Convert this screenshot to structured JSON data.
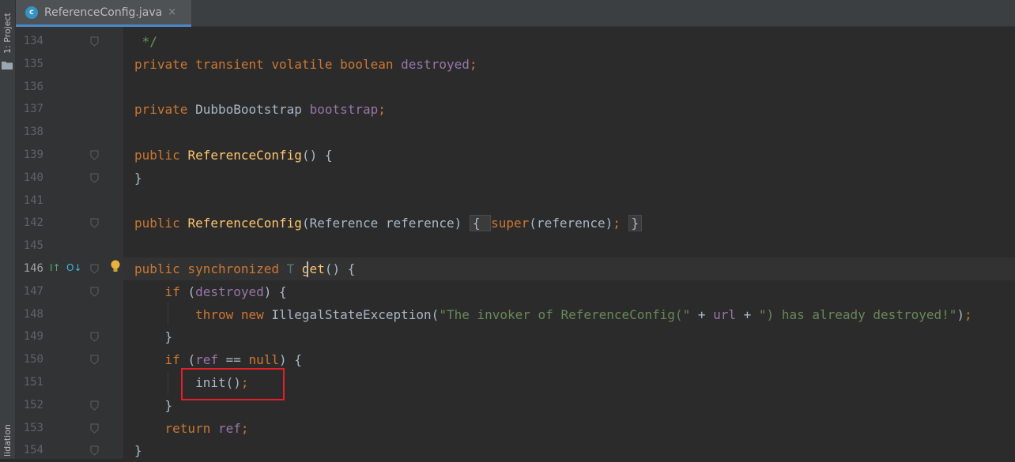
{
  "sidebar": {
    "project_label": "1: Project",
    "validation_label": "lidation"
  },
  "tab": {
    "icon_letter": "c",
    "title": "ReferenceConfig.java",
    "close_glyph": "×"
  },
  "gutter_icons": {
    "override_up": "I↑",
    "override_down": "O↓"
  },
  "colors": {
    "keyword": "#cc7832",
    "method": "#ffc66d",
    "field": "#9876aa",
    "string": "#6a8759",
    "comment": "#629755",
    "highlight_box": "#e3202a"
  },
  "lines": [
    {
      "num": "134",
      "tokens": [
        {
          "t": " */",
          "c": "cmt"
        }
      ]
    },
    {
      "num": "135",
      "tokens": [
        {
          "t": "private transient volatile boolean ",
          "c": "kw"
        },
        {
          "t": "destroyed",
          "c": "fld"
        },
        {
          "t": ";",
          "c": "kw"
        }
      ]
    },
    {
      "num": "136",
      "tokens": []
    },
    {
      "num": "137",
      "tokens": [
        {
          "t": "private ",
          "c": "kw"
        },
        {
          "t": "DubboBootstrap ",
          "c": ""
        },
        {
          "t": "bootstrap",
          "c": "fld"
        },
        {
          "t": ";",
          "c": "kw"
        }
      ]
    },
    {
      "num": "138",
      "tokens": []
    },
    {
      "num": "139",
      "tokens": [
        {
          "t": "public ",
          "c": "kw"
        },
        {
          "t": "ReferenceConfig",
          "c": "fn"
        },
        {
          "t": "() {",
          "c": ""
        }
      ]
    },
    {
      "num": "140",
      "tokens": [
        {
          "t": "}",
          "c": ""
        }
      ]
    },
    {
      "num": "141",
      "tokens": []
    },
    {
      "num": "142",
      "tokens": [
        {
          "t": "public ",
          "c": "kw"
        },
        {
          "t": "ReferenceConfig",
          "c": "fn"
        },
        {
          "t": "(Reference reference) ",
          "c": ""
        },
        {
          "t": "{ ",
          "c": "box"
        },
        {
          "t": "super",
          "c": "kw"
        },
        {
          "t": "(reference)",
          "c": ""
        },
        {
          "t": "; ",
          "c": "kw"
        },
        {
          "t": "}",
          "c": "box"
        }
      ]
    },
    {
      "num": "145",
      "tokens": []
    },
    {
      "num": "146",
      "tokens": [
        {
          "t": "public synchronized ",
          "c": "kw"
        },
        {
          "t": "T ",
          "c": "tp"
        },
        {
          "t": "get",
          "c": "fn"
        },
        {
          "t": "() {",
          "c": ""
        }
      ]
    },
    {
      "num": "147",
      "tokens": [
        {
          "t": "    if ",
          "c": "kw"
        },
        {
          "t": "(",
          "c": ""
        },
        {
          "t": "destroyed",
          "c": "fld"
        },
        {
          "t": ") {",
          "c": ""
        }
      ]
    },
    {
      "num": "148",
      "tokens": [
        {
          "t": "        throw new ",
          "c": "kw"
        },
        {
          "t": "IllegalStateException(",
          "c": ""
        },
        {
          "t": "\"The invoker of ReferenceConfig(\"",
          "c": "str"
        },
        {
          "t": " + ",
          "c": ""
        },
        {
          "t": "url",
          "c": "fld"
        },
        {
          "t": " + ",
          "c": ""
        },
        {
          "t": "\") has already destroyed!\"",
          "c": "str"
        },
        {
          "t": ")",
          "c": ""
        },
        {
          "t": ";",
          "c": "kw"
        }
      ]
    },
    {
      "num": "149",
      "tokens": [
        {
          "t": "    }",
          "c": ""
        }
      ]
    },
    {
      "num": "150",
      "tokens": [
        {
          "t": "    if ",
          "c": "kw"
        },
        {
          "t": "(",
          "c": ""
        },
        {
          "t": "ref",
          "c": "fld"
        },
        {
          "t": " == ",
          "c": ""
        },
        {
          "t": "null",
          "c": "kw"
        },
        {
          "t": ") {",
          "c": ""
        }
      ]
    },
    {
      "num": "151",
      "tokens": [
        {
          "t": "        init()",
          "c": ""
        },
        {
          "t": ";",
          "c": "kw"
        }
      ]
    },
    {
      "num": "152",
      "tokens": [
        {
          "t": "    }",
          "c": ""
        }
      ]
    },
    {
      "num": "153",
      "tokens": [
        {
          "t": "    return ",
          "c": "kw"
        },
        {
          "t": "ref",
          "c": "fld"
        },
        {
          "t": ";",
          "c": "kw"
        }
      ]
    },
    {
      "num": "154",
      "tokens": [
        {
          "t": "}",
          "c": ""
        }
      ]
    }
  ],
  "current_line": "146",
  "fold_lines": [
    "134",
    "139",
    "140",
    "142",
    "146",
    "147",
    "149",
    "150",
    "152",
    "153",
    "154"
  ]
}
